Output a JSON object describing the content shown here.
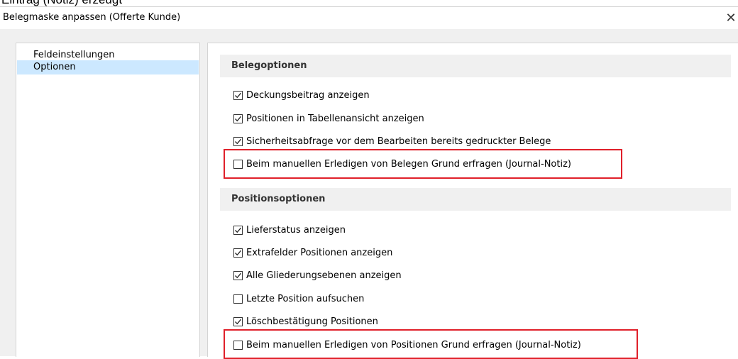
{
  "caption": "Eintrag (Notiz) erzeugt",
  "window": {
    "title": "Belegmaske anpassen (Offerte Kunde)",
    "close_glyph": "✕"
  },
  "nav": {
    "items": [
      {
        "label": "Feldeinstellungen",
        "selected": false
      },
      {
        "label": "Optionen",
        "selected": true
      }
    ]
  },
  "sections": {
    "beleg": {
      "header": "Belegoptionen",
      "options": [
        {
          "label": "Deckungsbeitrag anzeigen",
          "checked": true
        },
        {
          "label": "Positionen in Tabellenansicht anzeigen",
          "checked": true
        },
        {
          "label": "Sicherheitsabfrage vor dem Bearbeiten bereits gedruckter Belege",
          "checked": true
        },
        {
          "label": "Beim manuellen Erledigen von Belegen Grund erfragen (Journal-Notiz)",
          "checked": false,
          "highlighted": true
        }
      ]
    },
    "position": {
      "header": "Positionsoptionen",
      "options": [
        {
          "label": "Lieferstatus anzeigen",
          "checked": true
        },
        {
          "label": "Extrafelder Positionen anzeigen",
          "checked": true
        },
        {
          "label": "Alle Gliederungsebenen anzeigen",
          "checked": true
        },
        {
          "label": "Letzte Position aufsuchen",
          "checked": false
        },
        {
          "label": "Löschbestätigung Positionen",
          "checked": true
        },
        {
          "label": "Beim manuellen Erledigen von Positionen Grund erfragen (Journal-Notiz)",
          "checked": false,
          "highlighted": true
        }
      ]
    }
  },
  "colors": {
    "highlight": "#e0202a",
    "selection": "#cce8ff"
  }
}
